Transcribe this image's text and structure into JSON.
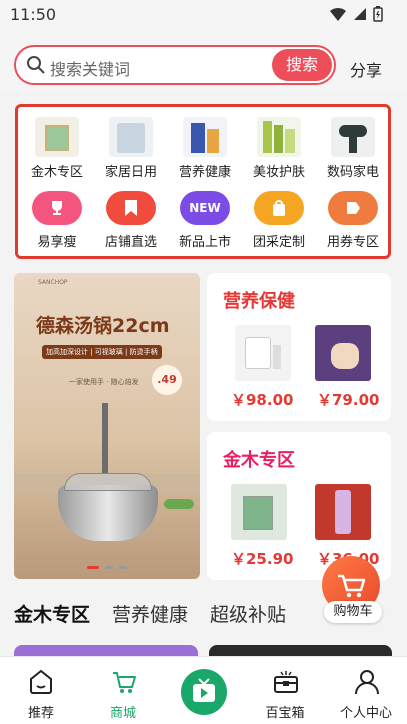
{
  "status_bar": {
    "time": "11:50"
  },
  "search": {
    "placeholder": "搜索关键词",
    "button_label": "搜索",
    "share_label": "分享"
  },
  "categories": [
    {
      "label": "金木专区",
      "icon": "product-thumb"
    },
    {
      "label": "家居日用",
      "icon": "product-thumb"
    },
    {
      "label": "营养健康",
      "icon": "product-thumb"
    },
    {
      "label": "美妆护肤",
      "icon": "product-thumb"
    },
    {
      "label": "数码家电",
      "icon": "product-thumb"
    },
    {
      "label": "易享瘦",
      "icon": "trophy-icon",
      "color": "#f4557f"
    },
    {
      "label": "店铺直选",
      "icon": "bookmark-icon",
      "color": "#f04b3c"
    },
    {
      "label": "新品上市",
      "icon": "new-badge",
      "badge_text": "NEW",
      "color": "#7b4ce6"
    },
    {
      "label": "团采定制",
      "icon": "bag-icon",
      "color": "#f5a623"
    },
    {
      "label": "用券专区",
      "icon": "coupon-icon",
      "color": "#f07b3f"
    }
  ],
  "banner": {
    "brand": "SANCHOP",
    "title": "德森汤锅22cm",
    "tag": "加高加深设计 | 可视玻璃 | 防烫手柄",
    "subtitle": "一家使用手 · 随心焙发",
    "badge": ".49",
    "page_indicator": {
      "count": 3,
      "active": 0
    }
  },
  "promo_cards": [
    {
      "title": "营养保健",
      "title_color": "#e53935",
      "products": [
        {
          "price": "￥98.00"
        },
        {
          "price": "￥79.00"
        }
      ]
    },
    {
      "title": "金木专区",
      "title_color": "#e91e63",
      "products": [
        {
          "price": "￥25.90"
        },
        {
          "price": "￥36.00"
        }
      ]
    }
  ],
  "floating_cart": {
    "label": "购物车"
  },
  "section_tabs": [
    {
      "label": "金木专区",
      "active": true
    },
    {
      "label": "营养健康",
      "active": false
    },
    {
      "label": "超级补贴",
      "active": false
    }
  ],
  "bottom_nav": [
    {
      "label": "推荐",
      "icon": "home-icon",
      "active": false
    },
    {
      "label": "商城",
      "icon": "cart-icon",
      "active": true
    },
    {
      "label": "",
      "icon": "tv-icon",
      "active": false
    },
    {
      "label": "百宝箱",
      "icon": "treasure-box-icon",
      "active": false
    },
    {
      "label": "个人中心",
      "icon": "person-icon",
      "active": false
    }
  ],
  "colors": {
    "accent": "#ee4d5a",
    "nav_active": "#1aa86a",
    "price": "#e53935"
  }
}
